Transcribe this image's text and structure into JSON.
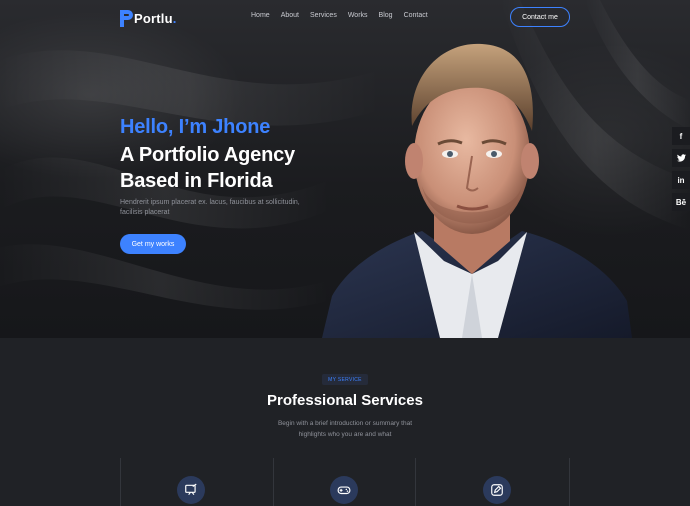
{
  "nav": {
    "logo_text": "Portlu",
    "logo_dot": ".",
    "links": [
      "Home",
      "About",
      "Services",
      "Works",
      "Blog",
      "Contact"
    ],
    "contact_button": "Contact me"
  },
  "hero": {
    "greeting": "Hello, I’m Jhone",
    "headline_line1": "A Portfolio Agency",
    "headline_line2": "Based in Florida",
    "description": "Hendrerit ipsum placerat ex. lacus, faucibus at sollicitudin, facilisis placerat",
    "cta_button": "Get my works"
  },
  "socials": [
    {
      "icon": "facebook-icon",
      "glyph": "f"
    },
    {
      "icon": "twitter-icon",
      "glyph": "🐦"
    },
    {
      "icon": "linkedin-icon",
      "glyph": "in"
    },
    {
      "icon": "behance-icon",
      "glyph": "Bē"
    }
  ],
  "services": {
    "badge": "MY SERVICE",
    "title": "Professional Services",
    "subtitle_line1": "Begin with a brief introduction or summary that",
    "subtitle_line2": "highlights who you are and what",
    "items": [
      {
        "icon": "design-board-icon"
      },
      {
        "icon": "gamepad-icon"
      },
      {
        "icon": "edit-icon"
      }
    ]
  },
  "colors": {
    "accent": "#3d82ff",
    "background": "#1f2126",
    "text_muted": "#8f929a"
  }
}
